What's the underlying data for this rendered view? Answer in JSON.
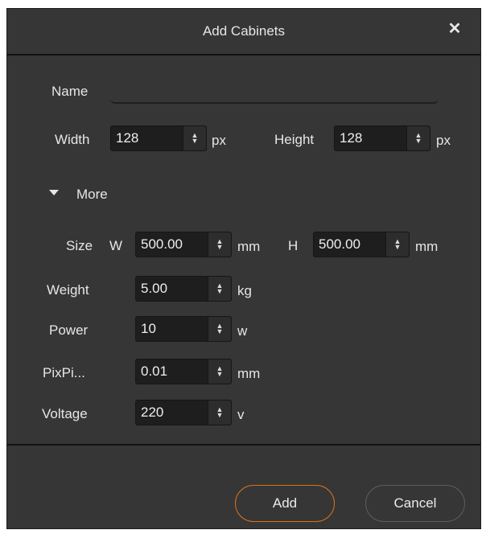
{
  "dialog": {
    "title": "Add Cabinets",
    "close_glyph": "✕"
  },
  "basic": {
    "name_label": "Name",
    "name_value": "",
    "width_label": "Width",
    "width_value": "128",
    "width_unit": "px",
    "height_label": "Height",
    "height_value": "128",
    "height_unit": "px"
  },
  "more": {
    "label": "More",
    "expanded": true
  },
  "size": {
    "label": "Size",
    "w_label": "W",
    "w_value": "500.00",
    "w_unit": "mm",
    "h_label": "H",
    "h_value": "500.00",
    "h_unit": "mm"
  },
  "weight": {
    "label": "Weight",
    "value": "5.00",
    "unit": "kg"
  },
  "power": {
    "label": "Power",
    "value": "10",
    "unit": "w"
  },
  "pixpitch": {
    "label": "PixPi...",
    "value": "0.01",
    "unit": "mm"
  },
  "voltage": {
    "label": "Voltage",
    "value": "220",
    "unit": "v"
  },
  "buttons": {
    "add": "Add",
    "cancel": "Cancel"
  },
  "colors": {
    "background": "#363636",
    "input": "#1e1e1e",
    "accent": "#d8731a",
    "text": "#e6e6e6"
  },
  "icons": {
    "close": "close-icon",
    "spin_arrows": "spin-arrows-icon",
    "expand": "triangle-down-icon"
  }
}
